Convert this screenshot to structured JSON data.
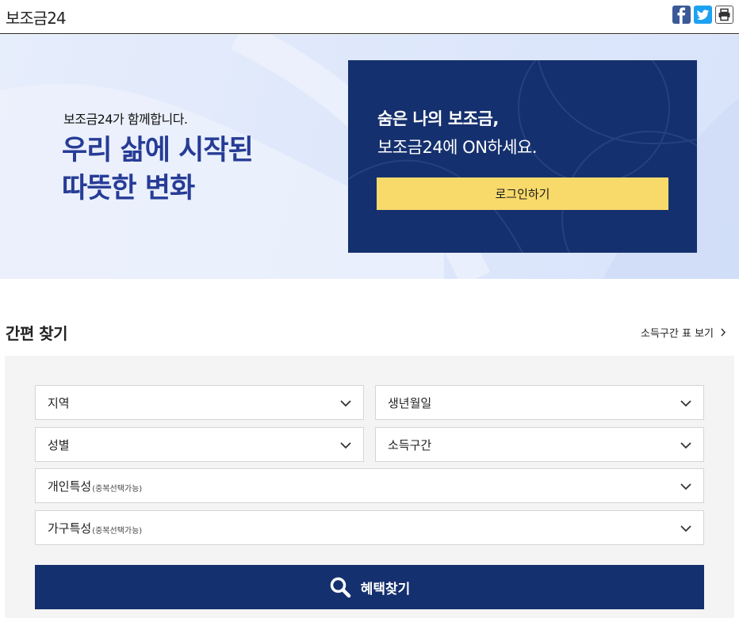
{
  "header": {
    "site_title": "보조금24",
    "share_icons": [
      "facebook-icon",
      "twitter-icon",
      "print-icon"
    ]
  },
  "hero": {
    "small_text": "보조금24가 함께합니다.",
    "headline_line1": "우리 삶에 시작된",
    "headline_line2": "따뜻한 변화",
    "login_line1": "숨은 나의 보조금,",
    "login_line2": "보조금24에 ON하세요.",
    "login_button": "로그인하기"
  },
  "quick_search": {
    "title": "간편 찾기",
    "income_table_link": "소득구간 표 보기",
    "fields": {
      "region": {
        "label": "지역"
      },
      "birth": {
        "label": "생년월일"
      },
      "gender": {
        "label": "성별"
      },
      "income": {
        "label": "소득구간"
      },
      "personal": {
        "label": "개인특성",
        "note": "(중복선택가능)"
      },
      "household": {
        "label": "가구특성",
        "note": "(중복선택가능)"
      }
    },
    "search_button": "혜택찾기"
  },
  "colors": {
    "navy": "#15306e",
    "accent_yellow": "#f8da6b",
    "headline_blue": "#263c96",
    "hero_bg": "#e1e9fb"
  }
}
